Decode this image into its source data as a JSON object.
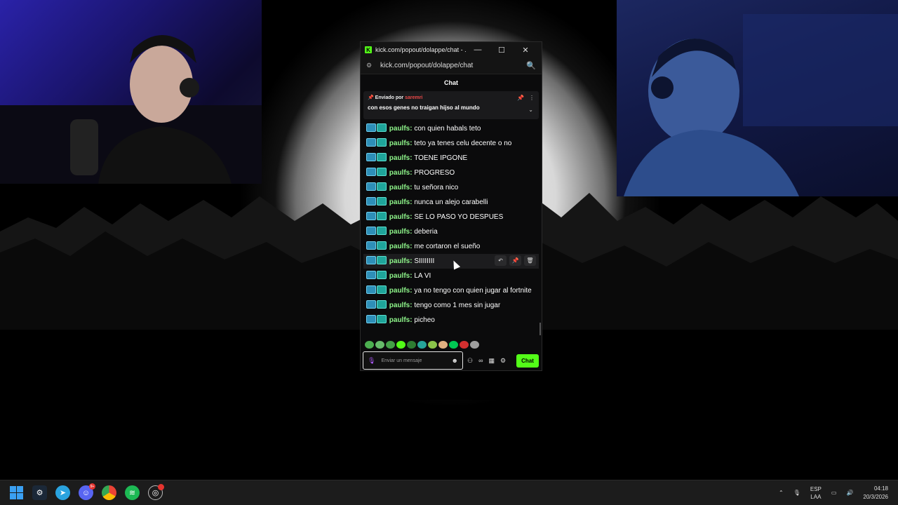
{
  "window": {
    "title": "kick.com/popout/dolappe/chat - ...",
    "minimize": "—",
    "maximize": "☐",
    "close": "✕",
    "url": "kick.com/popout/dolappe/chat"
  },
  "chat": {
    "header": "Chat",
    "pinned": {
      "sent_by_prefix": "Enviado por",
      "sent_by_user": "saremri",
      "message": "con esos genes no traigan hijso al mundo"
    },
    "messages": [
      {
        "user": "paulfs",
        "text": "con quien habals teto"
      },
      {
        "user": "paulfs",
        "text": "teto ya tenes celu decente o no"
      },
      {
        "user": "paulfs",
        "text": "TOENE IPGONE"
      },
      {
        "user": "paulfs",
        "text": "PROGRESO"
      },
      {
        "user": "paulfs",
        "text": "tu señora nico"
      },
      {
        "user": "paulfs",
        "text": "nunca un alejo carabelli"
      },
      {
        "user": "paulfs",
        "text": "SE LO PASO YO DESPUES"
      },
      {
        "user": "paulfs",
        "text": "deberia"
      },
      {
        "user": "paulfs",
        "text": "me cortaron el sueño"
      },
      {
        "user": "paulfs",
        "text": "SIIIIIIII"
      },
      {
        "user": "paulfs",
        "text": "LA VI"
      },
      {
        "user": "paulfs",
        "text": "ya no tengo con quien jugar al fortnite"
      },
      {
        "user": "paulfs",
        "text": "tengo como 1 mes sin jugar"
      },
      {
        "user": "paulfs",
        "text": "picheo"
      }
    ],
    "input_placeholder": "Enviar un mensaje",
    "send_label": "Chat"
  },
  "taskbar": {
    "discord_badge": "9+",
    "language": "ESP",
    "language_sub": "LAA",
    "time": "04:18",
    "date": "20/3/2026"
  },
  "colors": {
    "kick_green": "#53fc18",
    "username": "#8ef58a",
    "pinned_user": "#e94848"
  }
}
